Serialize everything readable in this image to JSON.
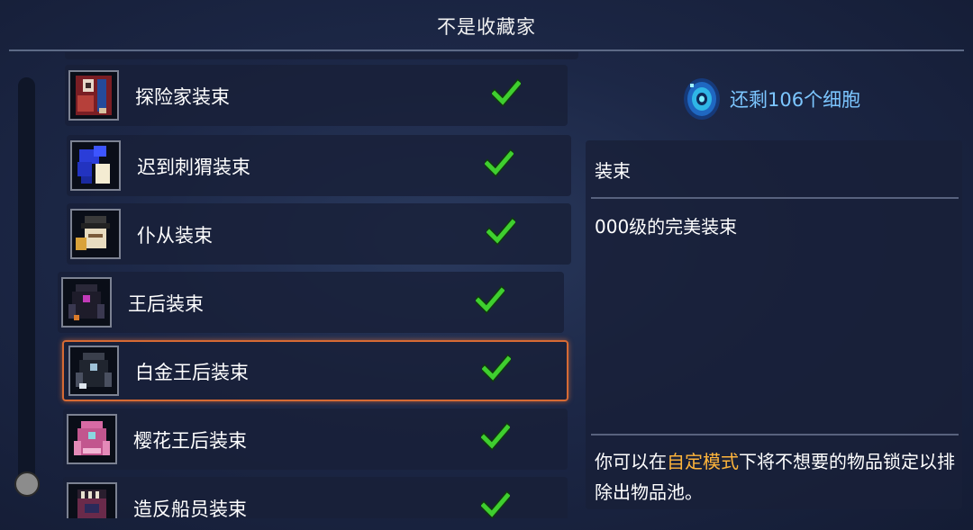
{
  "title": "不是收藏家",
  "cells": {
    "text": "还剩106个细胞",
    "icon": "cell-icon",
    "color": "#7cc6ff"
  },
  "outfits": [
    {
      "label": "探险家装束",
      "icon": "explorer-outfit-icon",
      "unlocked": true
    },
    {
      "label": "迟到刺猬装束",
      "icon": "late-hedgehog-outfit-icon",
      "unlocked": true
    },
    {
      "label": "仆从装束",
      "icon": "servant-outfit-icon",
      "unlocked": true
    },
    {
      "label": "王后装束",
      "icon": "queen-outfit-icon",
      "unlocked": true
    },
    {
      "label": "白金王后装束",
      "icon": "platinum-queen-outfit-icon",
      "unlocked": true,
      "selected": true
    },
    {
      "label": "樱花王后装束",
      "icon": "sakura-queen-outfit-icon",
      "unlocked": true
    },
    {
      "label": "造反船员装束",
      "icon": "mutineer-outfit-icon",
      "unlocked": true
    }
  ],
  "info": {
    "category": "装束",
    "description": "000级的完美装束",
    "hint_prefix": "你可以在",
    "hint_highlight": "自定模式",
    "hint_suffix": "下将不想要的物品锁定以排除出物品池。",
    "highlight_color": "#ffb53b"
  },
  "colors": {
    "selection_border": "#d66a34",
    "check": "#3fcf2f"
  }
}
